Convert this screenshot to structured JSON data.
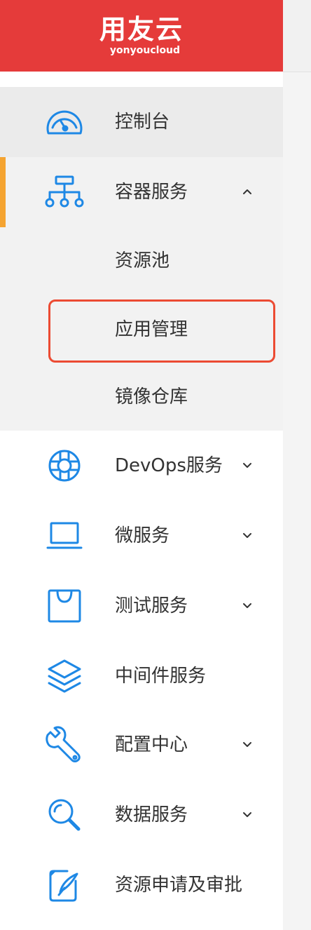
{
  "header": {
    "logo_text": "用友云",
    "logo_subtext": "yonyoucloud"
  },
  "colors": {
    "brand_red": "#e53b3a",
    "icon_blue": "#1e88e5",
    "active_accent": "#f5a431",
    "highlight_border": "#ec4b33"
  },
  "nav": {
    "items": [
      {
        "label": "控制台",
        "icon": "dashboard-gauge-icon",
        "has_chevron": false
      },
      {
        "label": "容器服务",
        "icon": "container-hierarchy-icon",
        "has_chevron": true,
        "expanded": true,
        "children": [
          {
            "label": "资源池"
          },
          {
            "label": "应用管理",
            "highlighted": true
          },
          {
            "label": "镜像仓库"
          }
        ]
      },
      {
        "label": "DevOps服务",
        "icon": "lifebuoy-icon",
        "has_chevron": true
      },
      {
        "label": "微服务",
        "icon": "laptop-icon",
        "has_chevron": true
      },
      {
        "label": "测试服务",
        "icon": "bag-icon",
        "has_chevron": true
      },
      {
        "label": "中间件服务",
        "icon": "layers-icon",
        "has_chevron": false
      },
      {
        "label": "配置中心",
        "icon": "wrench-icon",
        "has_chevron": true
      },
      {
        "label": "数据服务",
        "icon": "magnifier-icon",
        "has_chevron": true
      },
      {
        "label": "资源申请及审批",
        "icon": "edit-document-icon",
        "has_chevron": false
      }
    ]
  }
}
